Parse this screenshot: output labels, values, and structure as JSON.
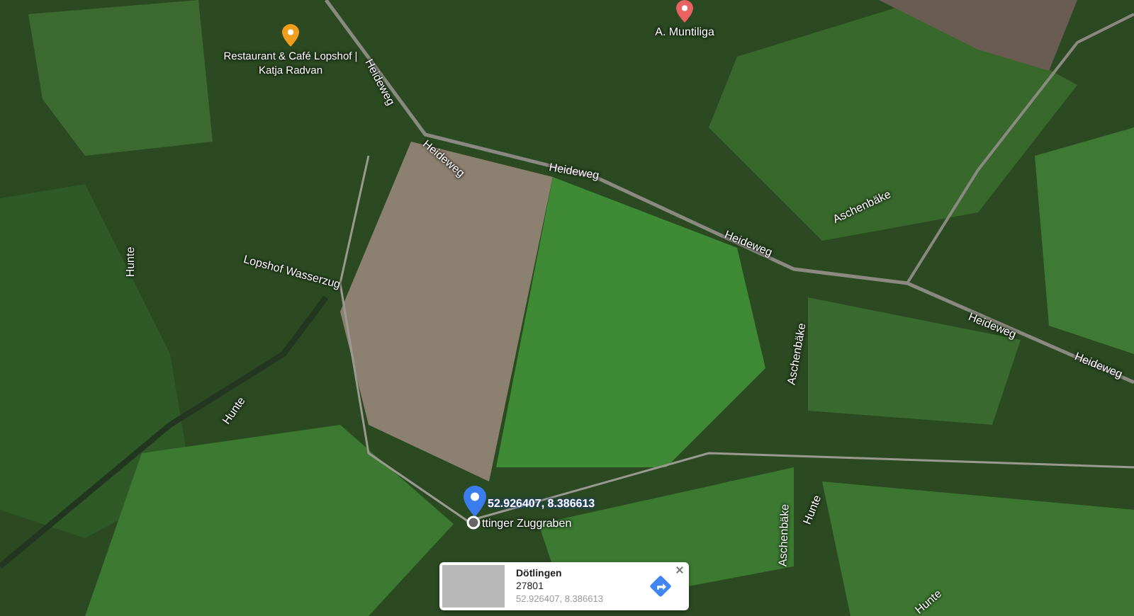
{
  "map": {
    "places": [
      {
        "name": "Restaurant & Café Lopshof | Katja Radvan",
        "kind": "food"
      },
      {
        "name": "A. Muntiliga",
        "kind": "shop"
      }
    ],
    "labels": [
      "Heideweg",
      "Heideweg",
      "Heideweg",
      "Heideweg",
      "Heideweg",
      "Heideweg",
      "Hunte",
      "Hunte",
      "Hunte",
      "Hunte",
      "Lopshof Wasserzug",
      "Aschenbäke",
      "Aschenbäke",
      "Aschenbäke"
    ],
    "pin": {
      "coordinates": "52.926407, 8.386613",
      "street": "ttinger Zuggraben"
    }
  },
  "info_card": {
    "title": "Dötlingen",
    "postcode": "27801",
    "coordinates": "52.926407, 8.386613"
  }
}
